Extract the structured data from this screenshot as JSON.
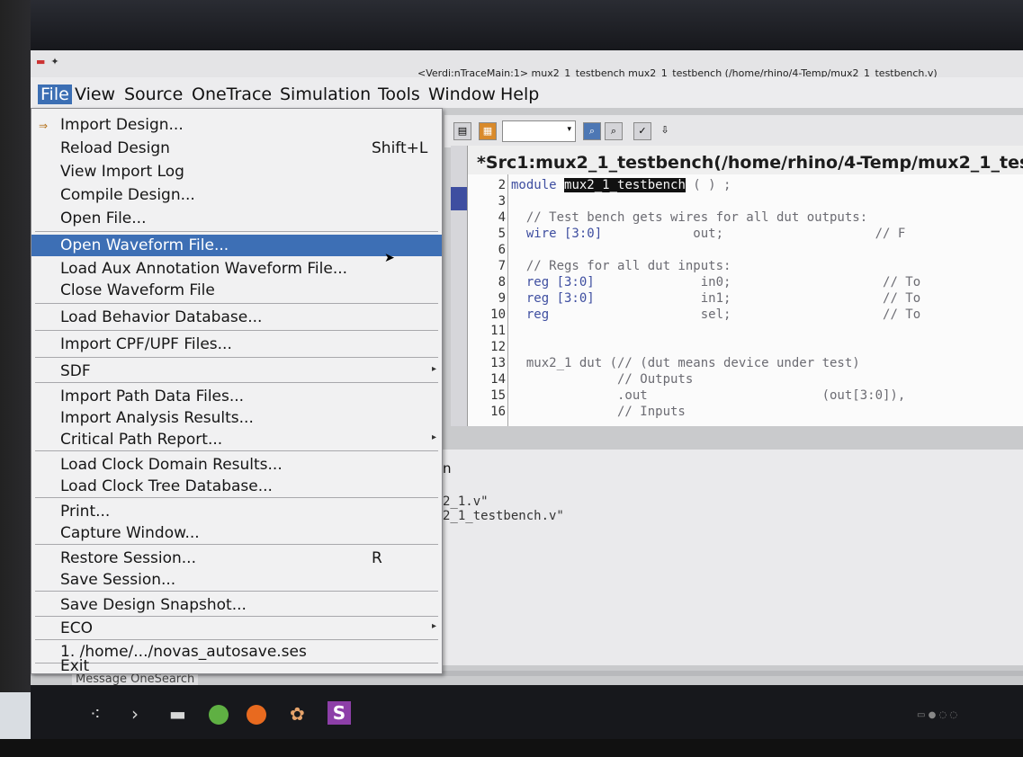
{
  "window": {
    "title": "<Verdi:nTraceMain:1> mux2_1_testbench mux2_1_testbench (/home/rhino/4-Temp/mux2_1_testbench.v)"
  },
  "menubar": {
    "items": [
      "File",
      "View",
      "Source",
      "OneTrace",
      "Simulation",
      "Tools",
      "Window",
      "Help"
    ]
  },
  "file_menu": {
    "import_design": "Import Design...",
    "reload_design": "Reload Design",
    "reload_design_shortcut": "Shift+L",
    "view_import_log": "View Import Log",
    "compile_design": "Compile Design...",
    "open_file": "Open File...",
    "open_waveform": "Open Waveform File...",
    "load_aux": "Load Aux Annotation Waveform File...",
    "close_waveform": "Close Waveform File",
    "load_behavior": "Load Behavior Database...",
    "import_cpf": "Import CPF/UPF Files...",
    "sdf": "SDF",
    "import_path": "Import Path Data Files...",
    "import_analysis": "Import Analysis Results...",
    "critical_path": "Critical Path Report...",
    "load_clock_domain": "Load Clock Domain Results...",
    "load_clock_tree": "Load Clock Tree Database...",
    "print": "Print...",
    "capture_window": "Capture Window...",
    "restore_session": "Restore Session...",
    "restore_session_shortcut": "R",
    "save_session": "Save Session...",
    "save_snapshot": "Save Design Snapshot...",
    "eco": "ECO",
    "recent": "1. /home/.../novas_autosave.ses",
    "exit": "Exit"
  },
  "source": {
    "tab_title": "*Src1:mux2_1_testbench(/home/rhino/4-Temp/mux2_1_testben",
    "lines": [
      {
        "n": "2",
        "parts": [
          {
            "t": "module ",
            "c": "kw"
          },
          {
            "t": "mux2_1_testbench",
            "c": "hl"
          },
          {
            "t": " ( ) ;",
            "c": "cm"
          }
        ]
      },
      {
        "n": "3",
        "parts": []
      },
      {
        "n": "4",
        "parts": [
          {
            "t": "  // Test bench gets wires for all dut outputs:",
            "c": "cm"
          }
        ]
      },
      {
        "n": "5",
        "parts": [
          {
            "t": "  wire [3:0]",
            "c": "kw"
          },
          {
            "t": "            out;                    // F",
            "c": "cm"
          }
        ]
      },
      {
        "n": "6",
        "parts": []
      },
      {
        "n": "7",
        "parts": [
          {
            "t": "  // Regs for all dut inputs:",
            "c": "cm"
          }
        ]
      },
      {
        "n": "8",
        "parts": [
          {
            "t": "  reg [3:0]",
            "c": "kw"
          },
          {
            "t": "              in0;                    // To",
            "c": "cm"
          }
        ]
      },
      {
        "n": "9",
        "parts": [
          {
            "t": "  reg [3:0]",
            "c": "kw"
          },
          {
            "t": "              in1;                    // To",
            "c": "cm"
          }
        ]
      },
      {
        "n": "10",
        "parts": [
          {
            "t": "  reg",
            "c": "kw"
          },
          {
            "t": "                    sel;                    // To",
            "c": "cm"
          }
        ]
      },
      {
        "n": "11",
        "parts": []
      },
      {
        "n": "12",
        "parts": []
      },
      {
        "n": "13",
        "parts": [
          {
            "t": "  mux2_1 dut (// (dut means device under test)",
            "c": "cm"
          }
        ]
      },
      {
        "n": "14",
        "parts": [
          {
            "t": "              // Outputs",
            "c": "cm"
          }
        ]
      },
      {
        "n": "15",
        "parts": [
          {
            "t": "              .out                       (out[3:0]),",
            "c": "cm"
          }
        ]
      },
      {
        "n": "16",
        "parts": [
          {
            "t": "              // Inputs",
            "c": "cm"
          }
        ]
      }
    ]
  },
  "lower_pane": {
    "tab_fragment": "n",
    "line1": "2_1.v\"",
    "line2": "2_1_testbench.v\""
  },
  "bottom_tabs": "Message OneSearch",
  "colors": {
    "selection": "#3d6fb5",
    "keyword": "#3e4ea0",
    "highlight": "#111111"
  }
}
